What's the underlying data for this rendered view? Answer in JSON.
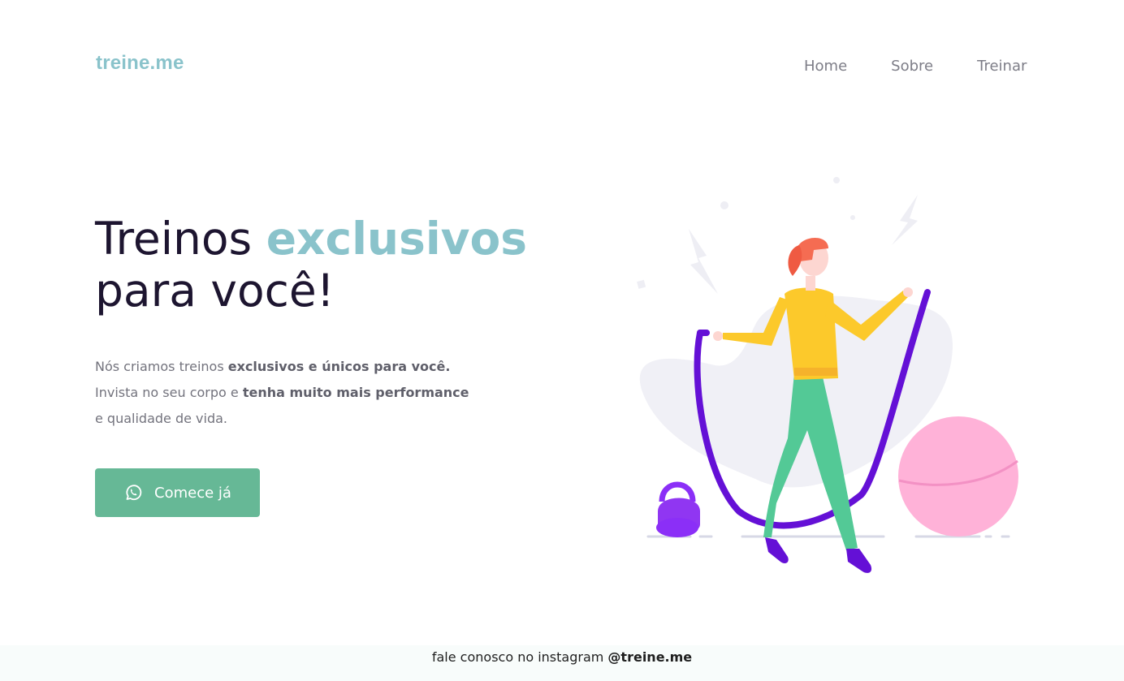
{
  "brand": {
    "logo": "treine.me"
  },
  "nav": {
    "items": [
      "Home",
      "Sobre",
      "Treinar"
    ]
  },
  "hero": {
    "title_part1": "Treinos ",
    "title_accent": "exclusivos",
    "title_part2": " para você!",
    "text": {
      "p1": "Nós criamos treinos ",
      "b1": "exclusivos e únicos para você.",
      "p2": "Invista no seu corpo e ",
      "b2": "tenha muito mais performance",
      "p3": " e qualidade de vida."
    },
    "cta_label": "Comece já",
    "cta_icon": "whatsapp-icon"
  },
  "footer": {
    "text": "fale conosco no instagram ",
    "handle": "@treine.me"
  },
  "colors": {
    "accent": "#8ac3cb",
    "cta": "#66b896",
    "title": "#1d1530",
    "text": "#73737d"
  }
}
